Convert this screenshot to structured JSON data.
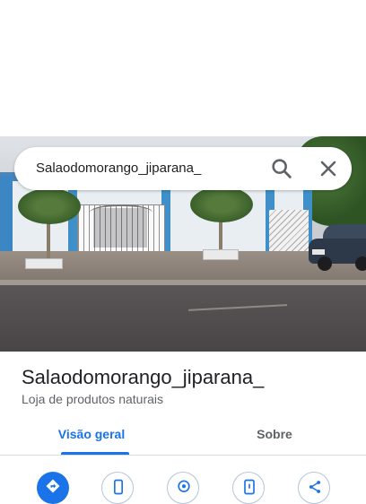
{
  "search": {
    "query": "Salaodomorango_jiparana_",
    "search_icon": "search-icon",
    "close_icon": "close-icon"
  },
  "place": {
    "name": "Salaodomorango_jiparana_",
    "category": "Loja de produtos naturais"
  },
  "tabs": [
    {
      "label": "Visão geral",
      "active": true
    },
    {
      "label": "Sobre",
      "active": false
    }
  ],
  "actions": [
    {
      "icon": "directions-icon"
    },
    {
      "icon": "phone-icon"
    },
    {
      "icon": "location-icon"
    },
    {
      "icon": "save-icon"
    },
    {
      "icon": "share-icon"
    }
  ],
  "colors": {
    "accent": "#1a73e8",
    "text_primary": "#202124",
    "text_secondary": "#5f6368"
  }
}
